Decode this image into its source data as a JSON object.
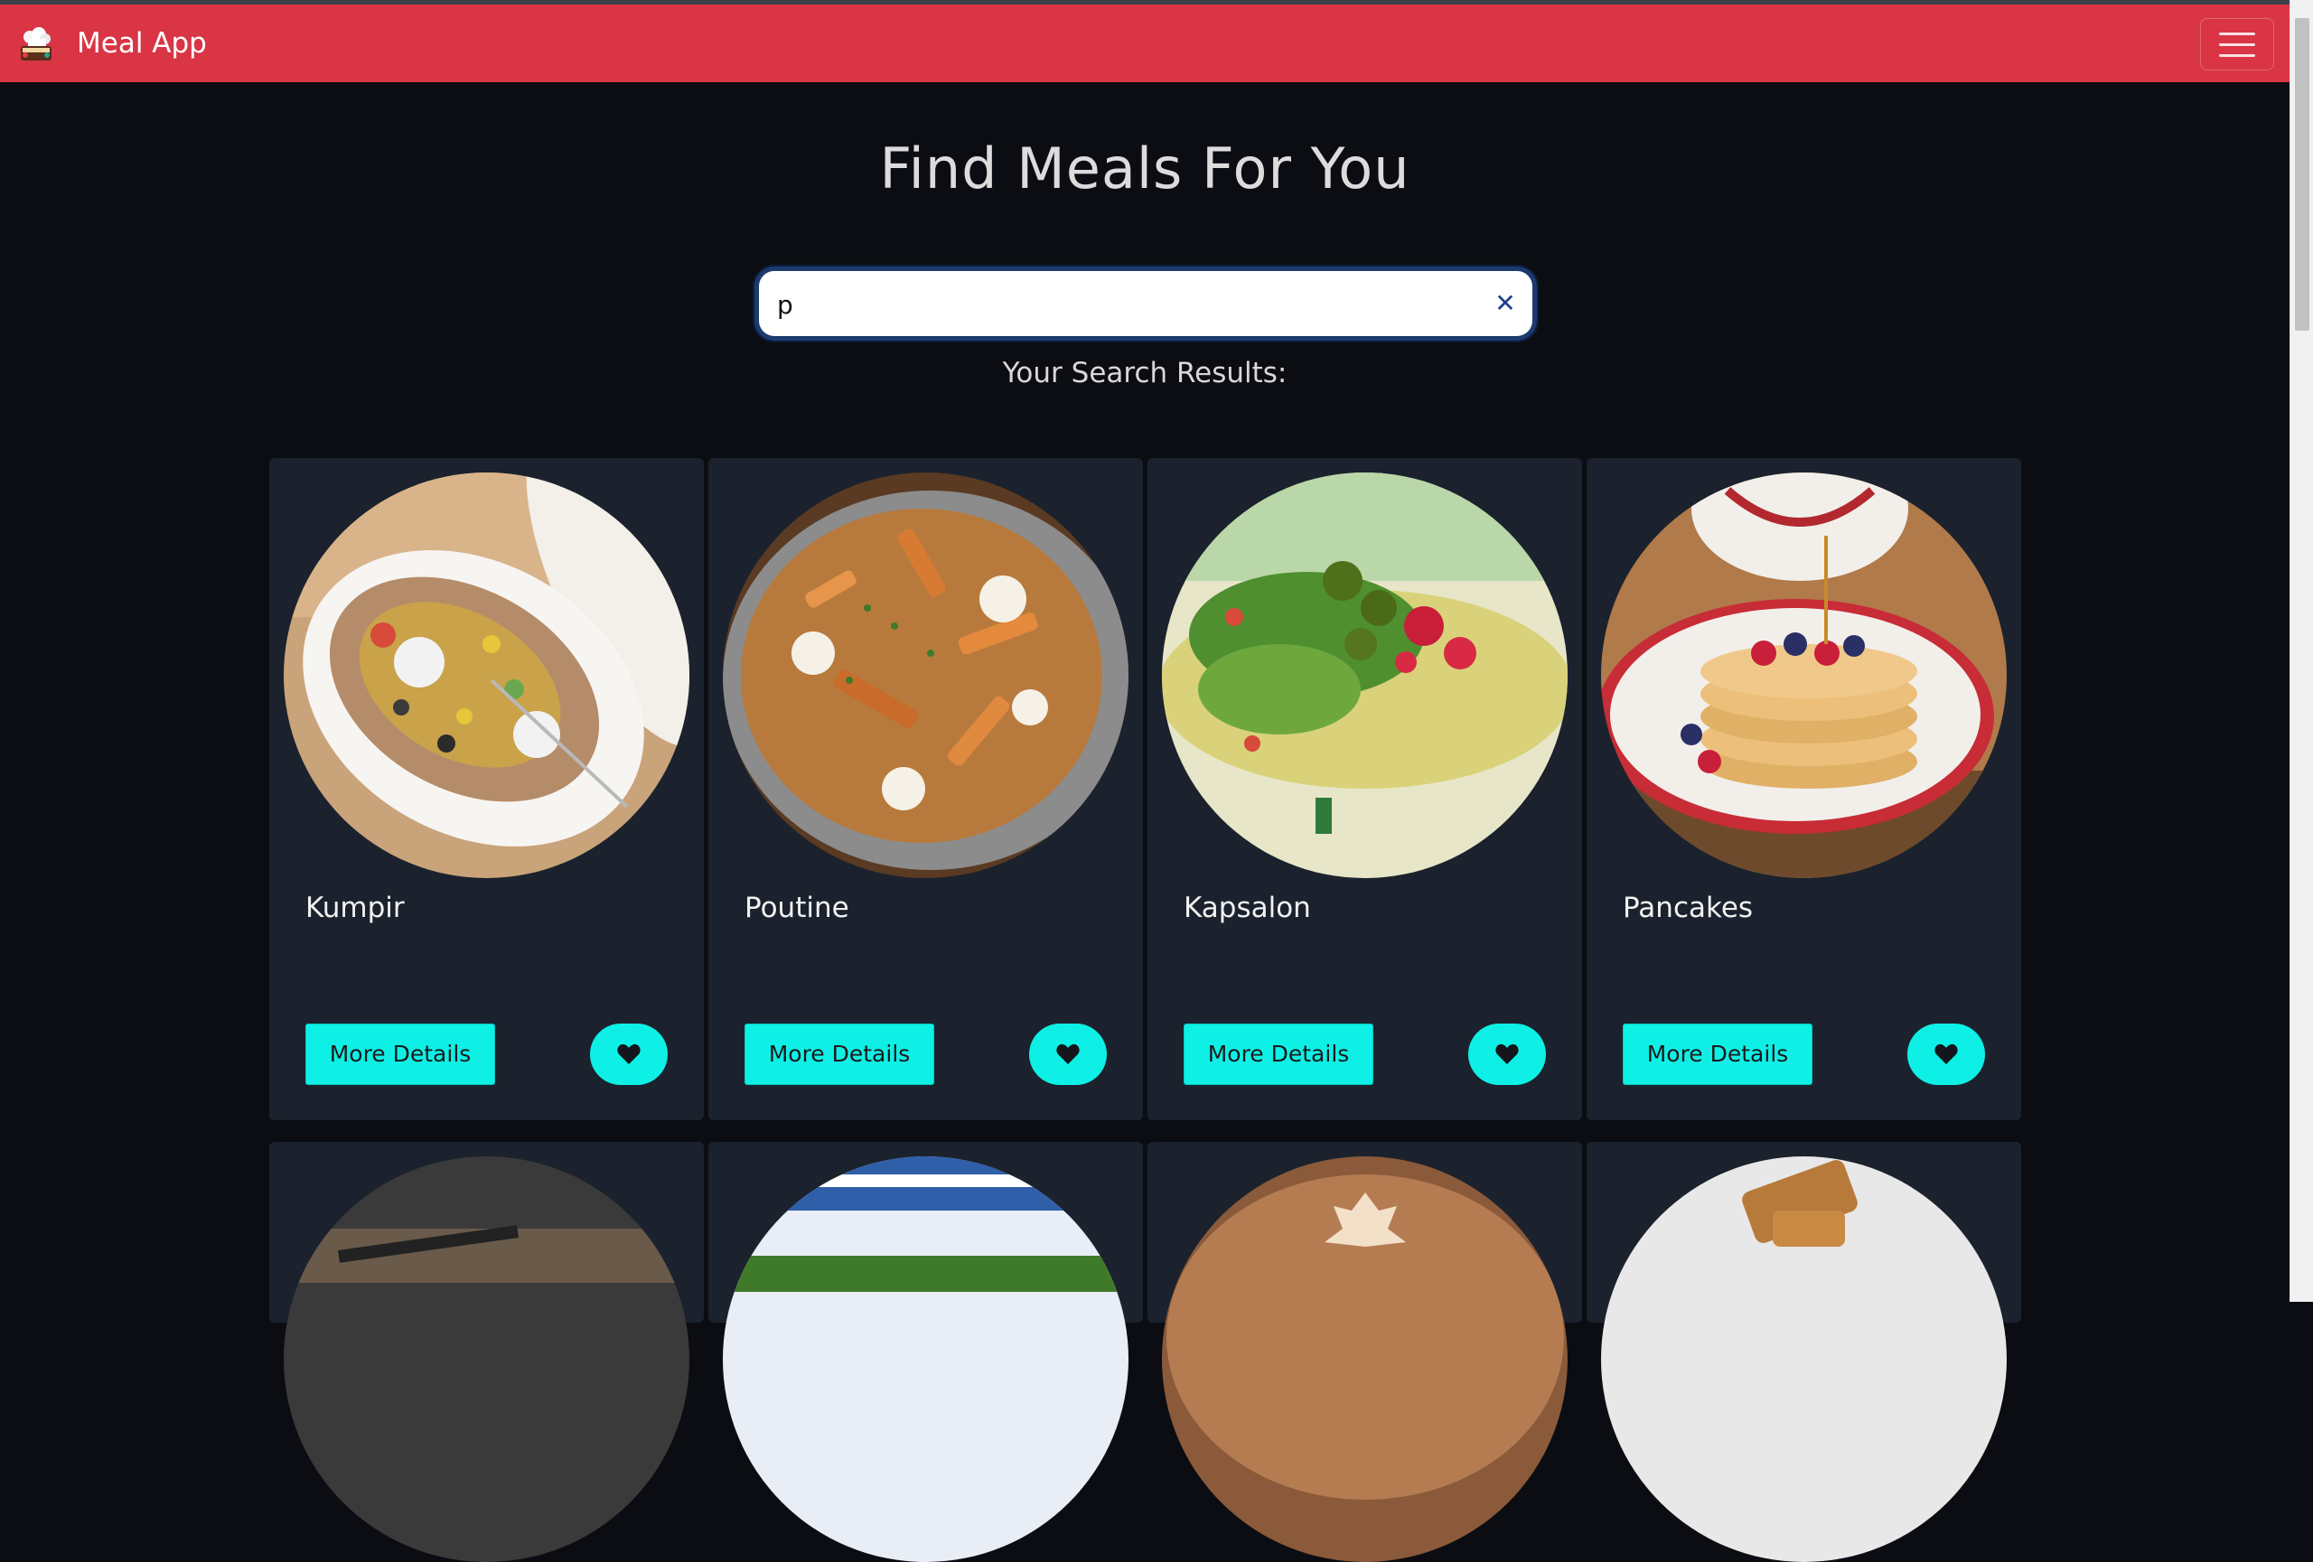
{
  "navbar": {
    "brand_name": "Meal App",
    "logo_icon": "chef-hat-logo-icon",
    "menu_icon": "hamburger-menu-icon",
    "background": "#d93545"
  },
  "main": {
    "title": "Find Meals For You",
    "search": {
      "value": "p",
      "clear_icon": "close-icon"
    },
    "results_heading": "Your Search Results:"
  },
  "meals": [
    {
      "name": "Kumpir",
      "details_label": "More Details",
      "fav_icon": "heart-icon"
    },
    {
      "name": "Poutine",
      "details_label": "More Details",
      "fav_icon": "heart-icon"
    },
    {
      "name": "Kapsalon",
      "details_label": "More Details",
      "fav_icon": "heart-icon"
    },
    {
      "name": "Pancakes",
      "details_label": "More Details",
      "fav_icon": "heart-icon"
    }
  ],
  "colors": {
    "accent": "#0ef0e6",
    "card_bg": "#1b222d",
    "page_bg": "#0b0d12"
  }
}
